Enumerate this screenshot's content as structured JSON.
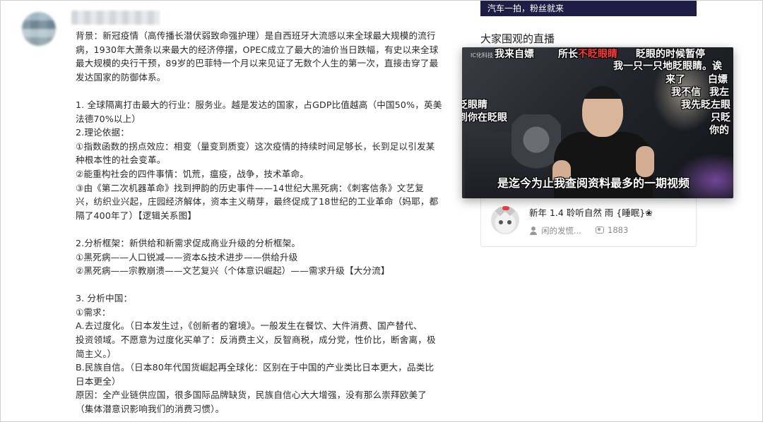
{
  "post": {
    "author_name": "",
    "paragraphs": [
      "背景：新冠疫情（高传播长潜伏弱致命强护理）是自西班牙大流感以来全球最大规模的流行",
      "病，1930年大萧条以来最大的经济停摆，OPEC成立了最大的油价当日跌幅，有史以来全球",
      "最大规模的央行干预，89岁的巴菲特一个月以来见证了无数个人生的第一次，直接击穿了最",
      "发达国家的防御体系。",
      "",
      "1. 全球隔离打击最大的行业：服务业。越是发达的国家，占GDP比值越高（中国50%，英美",
      "法德70%以上）",
      "2.理论依据：",
      "①指数函数的拐点效应：相变（量变到质变）这次疫情的持续时间足够长，长到足以引发某",
      "种根本性的社会变革。",
      "②能重构社会的四件事情：饥荒，瘟疫，战争，技术革命。",
      "③由《第二次机器革命》找到押韵的历史事件——14世纪大黑死病：《刺客信条》文艺复",
      "兴，纺织业兴起，庄园经济解体，资本主义萌芽，最终促成了18世纪的工业革命（妈耶，都",
      "隔了400年了）【逻辑关系图】",
      "",
      "2.分析框架：新供给和新需求促成商业升级的分析框架。",
      "①黑死病——人口锐减——资本&技术进步——供给升级",
      "②黑死病——宗教崩溃——文艺复兴（个体意识崛起）——需求升级【大分流】",
      "",
      "3. 分析中国：",
      "①需求：",
      "A.去过度化。（日本发生过，《创新者的窘境》。一般发生在餐饮、大件消费、国产替代、",
      "投资领域。不愿意为过度化买单了：反消费主义，反智商税，成分党，性价比，断舍离，极",
      "简主义。）",
      "B.民族自信。（日本80年代国货崛起再全球化：区别在于中国的产业类比日本更大，品类比",
      "日本更全）",
      "原因：全产业链供应国，很多国际品牌缺货，民族自信心大大增强，没有那么崇拜欧美了",
      "（集体潜意识影响我们的消费习惯）。"
    ]
  },
  "sidebar": {
    "top_banner": "汽车一拍，粉丝就来",
    "live_section_title": "大家围观的直播",
    "video": {
      "watermark": "IC化科技",
      "subtitle": "是迄今为止我查阅资料最多的一期视频",
      "danmaku": [
        {
          "text": "我来自嫖"
        },
        {
          "text_a": "所长",
          "text_b": "不眨眼睛"
        },
        {
          "text": "眨眼的时候暂停"
        },
        {
          "text": "我一只一只地眨眼睛。诶"
        },
        {
          "text": "来了"
        },
        {
          "text": "白嫖"
        },
        {
          "text": "我不信"
        },
        {
          "text": "我左"
        },
        {
          "text": "眨眼睛"
        },
        {
          "text": "我先眨左眼"
        },
        {
          "text": "到你在眨眼"
        },
        {
          "text": "只眨"
        },
        {
          "text": "你的"
        }
      ]
    },
    "recommend": {
      "title": "新年 1.4 聆听自然 雨 {睡眠}❀",
      "user": "闲的发慌...",
      "views": "1883",
      "icons": [
        "user-icon",
        "view-icon"
      ]
    }
  }
}
